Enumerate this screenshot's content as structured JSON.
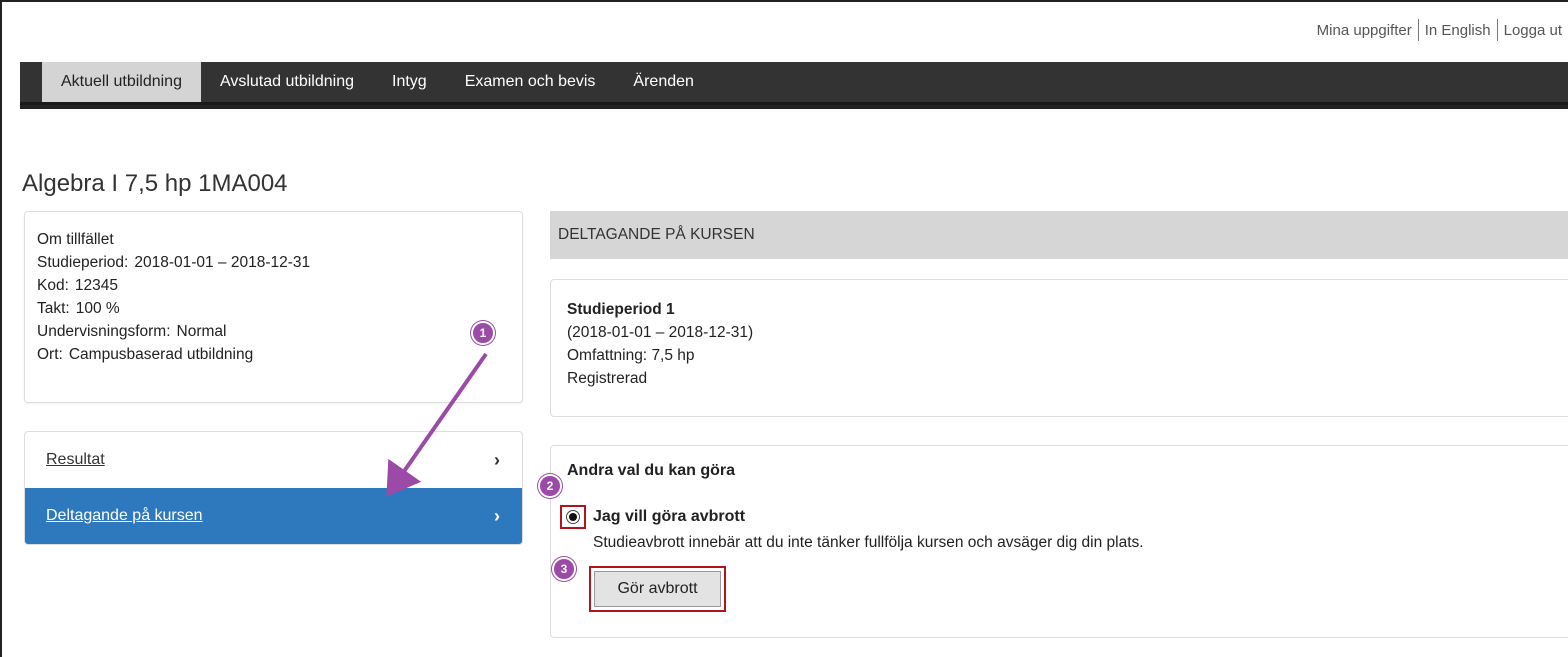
{
  "top_links": [
    "Mina uppgifter",
    "In English",
    "Logga ut"
  ],
  "nav": {
    "tabs": [
      "Aktuell utbildning",
      "Avslutad utbildning",
      "Intyg",
      "Examen och bevis",
      "Ärenden"
    ],
    "active_tab": "Aktuell utbildning"
  },
  "page_title": "Algebra I 7,5 hp 1MA004",
  "info": {
    "heading": "Om tillfället",
    "rows": [
      {
        "label": "Studieperiod:",
        "value": "2018-01-01 – 2018-12-31"
      },
      {
        "label": "Kod:",
        "value": "12345"
      },
      {
        "label": "Takt:",
        "value": "100 %"
      },
      {
        "label": "Undervisningsform:",
        "value": "Normal"
      },
      {
        "label": "Ort:",
        "value": "Campusbaserad utbildning"
      }
    ]
  },
  "side_menu": {
    "items": [
      {
        "label": "Resultat",
        "active": false
      },
      {
        "label": "Deltagande på kursen",
        "active": true
      }
    ]
  },
  "section_header": "DELTAGANDE PÅ KURSEN",
  "period": {
    "title": "Studieperiod 1",
    "dates": "(2018-01-01 – 2018-12-31)",
    "scope_label": "Omfattning:",
    "scope_value": "7,5 hp",
    "status": "Registrerad"
  },
  "choices": {
    "title": "Andra val du kan göra",
    "option_label": "Jag vill göra avbrott",
    "option_selected": true,
    "option_description": "Studieavbrott innebär att du inte tänker fullfölja kursen och avsäger dig din plats.",
    "button_label": "Gör avbrott"
  },
  "annotations": {
    "badges": [
      "1",
      "2",
      "3"
    ],
    "color": "#9b4aa8",
    "highlight_color": "#b0141c"
  }
}
